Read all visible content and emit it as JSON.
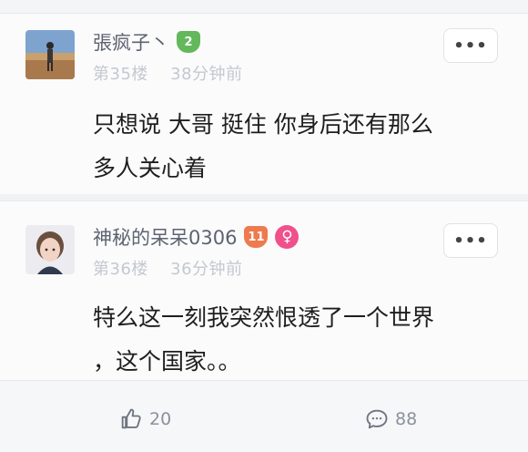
{
  "comments": [
    {
      "username": "張疯子丶",
      "level": "2",
      "floor": "第35楼",
      "time": "38分钟前",
      "more_label": "•••",
      "text_line1": "只想说 大哥 挺住 你身后还有那么",
      "text_line2": "多人关心着"
    },
    {
      "username": "神秘的呆呆0306",
      "level": "11",
      "floor": "第36楼",
      "time": "36分钟前",
      "more_label": "•••",
      "text_line1": "特么这一刻我突然恨透了一个世界",
      "text_line2": "，这个国家。。"
    }
  ],
  "footer": {
    "like_count": "20",
    "reply_count": "88"
  },
  "icons": {
    "like": "thumbs-up-icon",
    "reply": "comment-bubble-icon",
    "gender": "female-icon"
  },
  "colors": {
    "username": "#5c6370",
    "meta": "#c4c8cf",
    "level_green": "#63b85b",
    "level_orange": "#ef7a4e",
    "gender_pink": "#f0508c"
  }
}
